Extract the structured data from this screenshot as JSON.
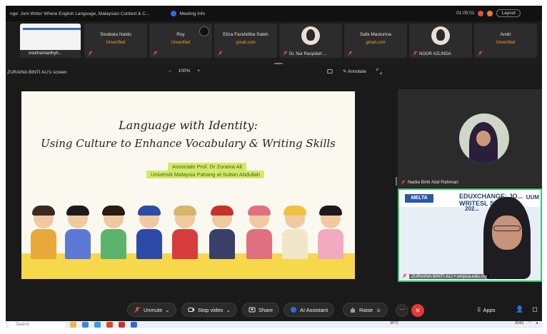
{
  "window": {
    "title": "nge: Jom Write! Where English Language, Malaysian Context & C...",
    "meeting_info": "Meeting Info",
    "timer": "01:05:01",
    "layout_label": "Layout"
  },
  "participants": [
    {
      "name": "noorhamiarthyh...",
      "status": "",
      "type": "slide-thumb"
    },
    {
      "name": "Sivabala Naidu",
      "status": "Unverified"
    },
    {
      "name": "Roy",
      "status": "Unverified"
    },
    {
      "name": "Eliza Farahdiba Saleh",
      "status": "gmail.com"
    },
    {
      "name": "Dr. Nur Rasyidah ...",
      "status": "",
      "type": "avatar"
    },
    {
      "name": "Safa Masturina",
      "status": "gmail.com"
    },
    {
      "name": "NOOR AZLINDA",
      "status": "",
      "type": "avatar"
    },
    {
      "name": "Andri",
      "status": "Unverified"
    }
  ],
  "share": {
    "label": "ZURAINA BINTI ALI's screen",
    "zoom_minus": "–",
    "zoom_value": "100%",
    "zoom_plus": "+",
    "annotate": "Annotate"
  },
  "slide": {
    "title1": "Language with Identity:",
    "title2": "Using Culture to Enhance Vocabulary & Writing Skills",
    "author": "Associate Prof. Dr Zuraina Ali",
    "affiliation": "Universiti Malaysia Pahang al-Sultan Abdullah"
  },
  "videos": [
    {
      "name": "Nadia Binti Abd Rahman"
    },
    {
      "name": "ZURAINA BINTI ALI • umpsa.edu.my",
      "banner": "EDUXCHANGE: JO... WRITESL SIG...",
      "logo": "MELTA",
      "brand": "UUM",
      "year": "202..."
    }
  ],
  "controls": {
    "unmute": "Unmute",
    "stop_video": "Stop video",
    "share": "Share",
    "ai_assistant": "AI Assistant",
    "raise": "Raise",
    "more": "···",
    "apps": "Apps"
  },
  "taskbar": {
    "search": "Search",
    "temperature": "30°C",
    "lang": "ENG"
  },
  "colors": {
    "end_red": "#e53935",
    "active_green": "#35c76f",
    "unverified_orange": "#f0a020"
  }
}
